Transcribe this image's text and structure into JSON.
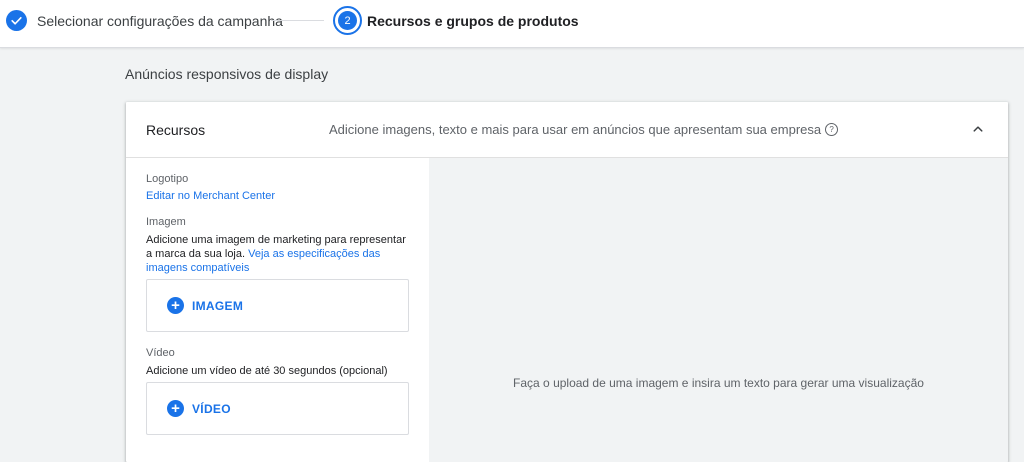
{
  "stepper": {
    "step1": {
      "label": "Selecionar configurações da campanha"
    },
    "step2": {
      "number": "2",
      "label": "Recursos e grupos de produtos"
    }
  },
  "section": {
    "title": "Anúncios responsivos de display"
  },
  "card": {
    "title": "Recursos",
    "description": "Adicione imagens, texto e mais para usar em anúncios que apresentam sua empresa"
  },
  "logo": {
    "label": "Logotipo",
    "link": "Editar no Merchant Center"
  },
  "image": {
    "label": "Imagem",
    "description": "Adicione uma imagem de marketing para representar a marca da sua loja.",
    "link": "Veja as especificações das imagens compatíveis",
    "button_label": "IMAGEM"
  },
  "video": {
    "label": "Vídeo",
    "description": "Adicione um vídeo de até 30 segundos (opcional)",
    "button_label": "VÍDEO"
  },
  "preview": {
    "placeholder": "Faça o upload de uma imagem e insira um texto para gerar uma visualização"
  },
  "colors": {
    "accent": "#1a73e8",
    "background": "#f1f3f4"
  }
}
